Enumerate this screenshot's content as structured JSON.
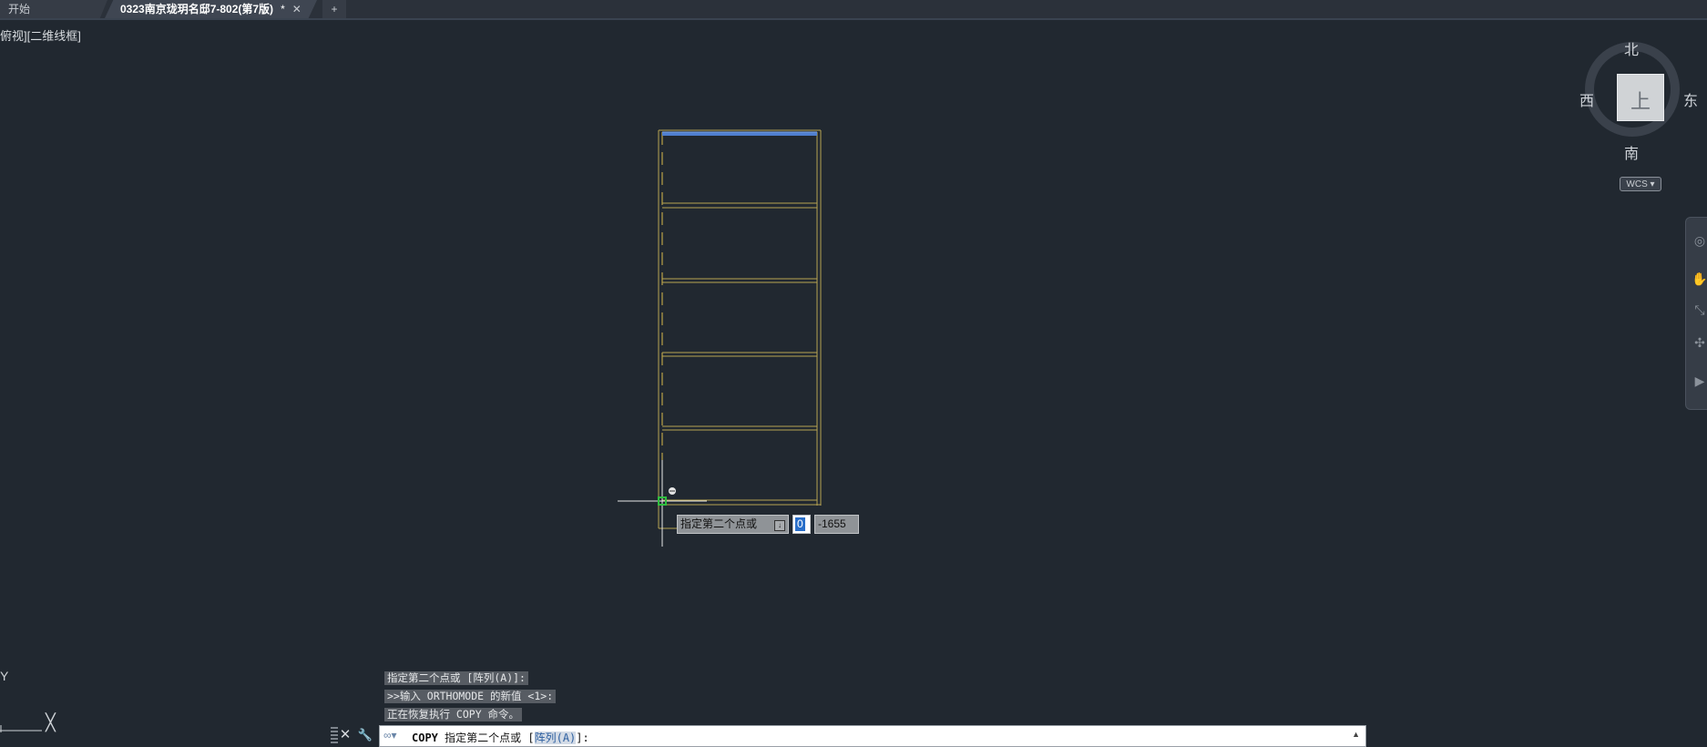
{
  "tabs": {
    "start_label": "开始",
    "document_label": "0323南京珑玥名邸7-802(第7版)",
    "document_modified_marker": "*",
    "close_glyph": "✕",
    "add_glyph": "+"
  },
  "viewport": {
    "label": "俯视][二维线框]"
  },
  "viewcube": {
    "north": "北",
    "south": "南",
    "west": "西",
    "east": "东",
    "top_face_glyph": "上",
    "wcs_label": "WCS ▾"
  },
  "navbar": {
    "icons": [
      "steering-wheel-icon",
      "pan-icon",
      "zoom-icon",
      "orbit-icon",
      "showmotion-icon"
    ]
  },
  "dynamic_input": {
    "prompt": "指定第二个点或",
    "prompt_arrow": "↓",
    "x_value": "0",
    "y_value": "-1655"
  },
  "command_history": [
    "指定第二个点或 [阵列(A)]:",
    ">>输入 ORTHOMODE 的新值 <1>:",
    "正在恢复执行 COPY 命令。"
  ],
  "command_line": {
    "icon": "∞▾",
    "command": "COPY",
    "prompt": "指定第二个点或 [",
    "option": "阵列(A)",
    "suffix": "]:",
    "close_glyph": "✕",
    "wrench_glyph": "🔧",
    "expand_glyph": "▲"
  },
  "ucs": {
    "y_label": "Y",
    "x_label": "╳"
  },
  "colors": {
    "background": "#212830",
    "shelf_lines": "#b8a352",
    "selected_edge": "#4f7fcf",
    "snap_marker": "#2fbf3f",
    "crosshair": "#e8e8e8"
  }
}
